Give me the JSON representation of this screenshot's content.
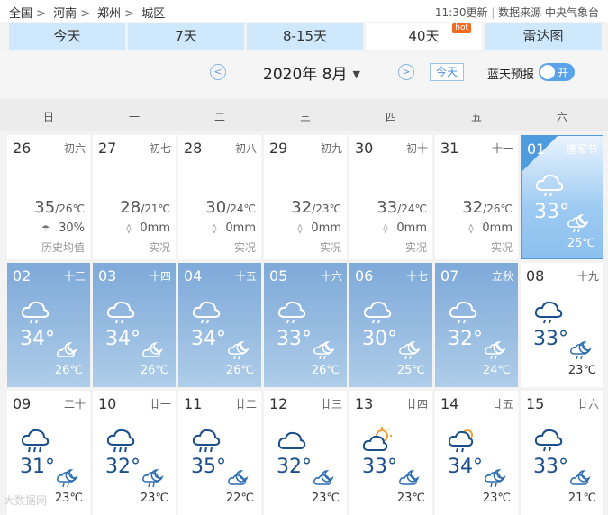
{
  "breadcrumb": {
    "items": [
      "全国",
      "河南",
      "郑州",
      "城区"
    ],
    "sep": ">"
  },
  "meta": {
    "updated": "11:30更新",
    "divider": "|",
    "source": "数据来源 中央气象台"
  },
  "tabs": [
    {
      "label": "今天"
    },
    {
      "label": "7天"
    },
    {
      "label": "8-15天"
    },
    {
      "label": "40天",
      "badge": "hot"
    },
    {
      "label": "雷达图"
    }
  ],
  "nav": {
    "prev": "<",
    "next": ">",
    "month": "2020年 8月",
    "caret": "▼",
    "today_btn": "今天",
    "blue_sky_label": "蓝天预报",
    "toggle_text": "开"
  },
  "weekdays": [
    "日",
    "一",
    "二",
    "三",
    "四",
    "五",
    "六"
  ],
  "colors": {
    "accent": "#4f9be0",
    "tab_bg": "#cfe8fb",
    "forecast_blue": "#7ea9d9",
    "hot": "#f26b24"
  },
  "past_days": [
    {
      "day": "26",
      "lunar": "初六",
      "hi": "35",
      "lo": "/26℃",
      "rain": "30%",
      "rain_icon": "rain-chance-icon",
      "note": "历史均值"
    },
    {
      "day": "27",
      "lunar": "初七",
      "hi": "28",
      "lo": "/21℃",
      "rain": "0mm",
      "rain_icon": "raindrop-icon",
      "note": "实况"
    },
    {
      "day": "28",
      "lunar": "初八",
      "hi": "30",
      "lo": "/24℃",
      "rain": "0mm",
      "rain_icon": "raindrop-icon",
      "note": "实况"
    },
    {
      "day": "29",
      "lunar": "初九",
      "hi": "32",
      "lo": "/23℃",
      "rain": "0mm",
      "rain_icon": "raindrop-icon",
      "note": "实况"
    },
    {
      "day": "30",
      "lunar": "初十",
      "hi": "33",
      "lo": "/24℃",
      "rain": "0mm",
      "rain_icon": "raindrop-icon",
      "note": "实况"
    },
    {
      "day": "31",
      "lunar": "十一",
      "hi": "32",
      "lo": "/26℃",
      "rain": "0mm",
      "rain_icon": "raindrop-icon",
      "note": "实况"
    }
  ],
  "today": {
    "day": "01",
    "lunar": "建军节",
    "hi": "33°",
    "lo": "25℃",
    "day_icon": "rain-cloud-icon",
    "night_icon": "night-rain-icon"
  },
  "week2": [
    {
      "day": "02",
      "lunar": "十三",
      "hi": "34°",
      "lo": "26℃",
      "day_icon": "rain-cloud-icon",
      "night_icon": "night-cloud-icon"
    },
    {
      "day": "03",
      "lunar": "十四",
      "hi": "34°",
      "lo": "26℃",
      "day_icon": "rain-cloud-icon",
      "night_icon": "night-cloud-icon"
    },
    {
      "day": "04",
      "lunar": "十五",
      "hi": "34°",
      "lo": "26℃",
      "day_icon": "rain-cloud-icon",
      "night_icon": "night-rain-icon"
    },
    {
      "day": "05",
      "lunar": "十六",
      "hi": "33°",
      "lo": "26℃",
      "day_icon": "rain-cloud-icon",
      "night_icon": "night-rain-icon"
    },
    {
      "day": "06",
      "lunar": "十七",
      "hi": "30°",
      "lo": "25℃",
      "day_icon": "rain-cloud-icon",
      "night_icon": "night-rain-icon"
    },
    {
      "day": "07",
      "lunar": "立秋",
      "hi": "32°",
      "lo": "24℃",
      "day_icon": "rain-cloud-icon",
      "night_icon": "night-rain-icon"
    },
    {
      "day": "08",
      "lunar": "十九",
      "hi": "33°",
      "lo": "23℃",
      "day_icon": "rain-cloud-icon",
      "night_icon": "night-rain-icon",
      "white": true
    }
  ],
  "week3": [
    {
      "day": "09",
      "lunar": "二十",
      "hi": "31°",
      "lo": "23℃",
      "day_icon": "heavy-rain-icon",
      "night_icon": "night-rain-icon"
    },
    {
      "day": "10",
      "lunar": "廿一",
      "hi": "32°",
      "lo": "23℃",
      "day_icon": "heavy-rain-icon",
      "night_icon": "night-rain-icon"
    },
    {
      "day": "11",
      "lunar": "廿二",
      "hi": "35°",
      "lo": "22℃",
      "day_icon": "heavy-rain-icon",
      "night_icon": "night-cloud-icon"
    },
    {
      "day": "12",
      "lunar": "廿三",
      "hi": "32°",
      "lo": "23℃",
      "day_icon": "cloudy-icon",
      "night_icon": "night-cloud-icon"
    },
    {
      "day": "13",
      "lunar": "廿四",
      "hi": "33°",
      "lo": "23℃",
      "day_icon": "sun-cloud-icon",
      "night_icon": "night-cloud-icon"
    },
    {
      "day": "14",
      "lunar": "廿五",
      "hi": "34°",
      "lo": "23℃",
      "day_icon": "sun-rain-icon",
      "night_icon": "night-rain-icon"
    },
    {
      "day": "15",
      "lunar": "廿六",
      "hi": "33°",
      "lo": "21℃",
      "day_icon": "rain-cloud-icon",
      "night_icon": "night-cloud-icon"
    }
  ],
  "watermark": "大数据网"
}
